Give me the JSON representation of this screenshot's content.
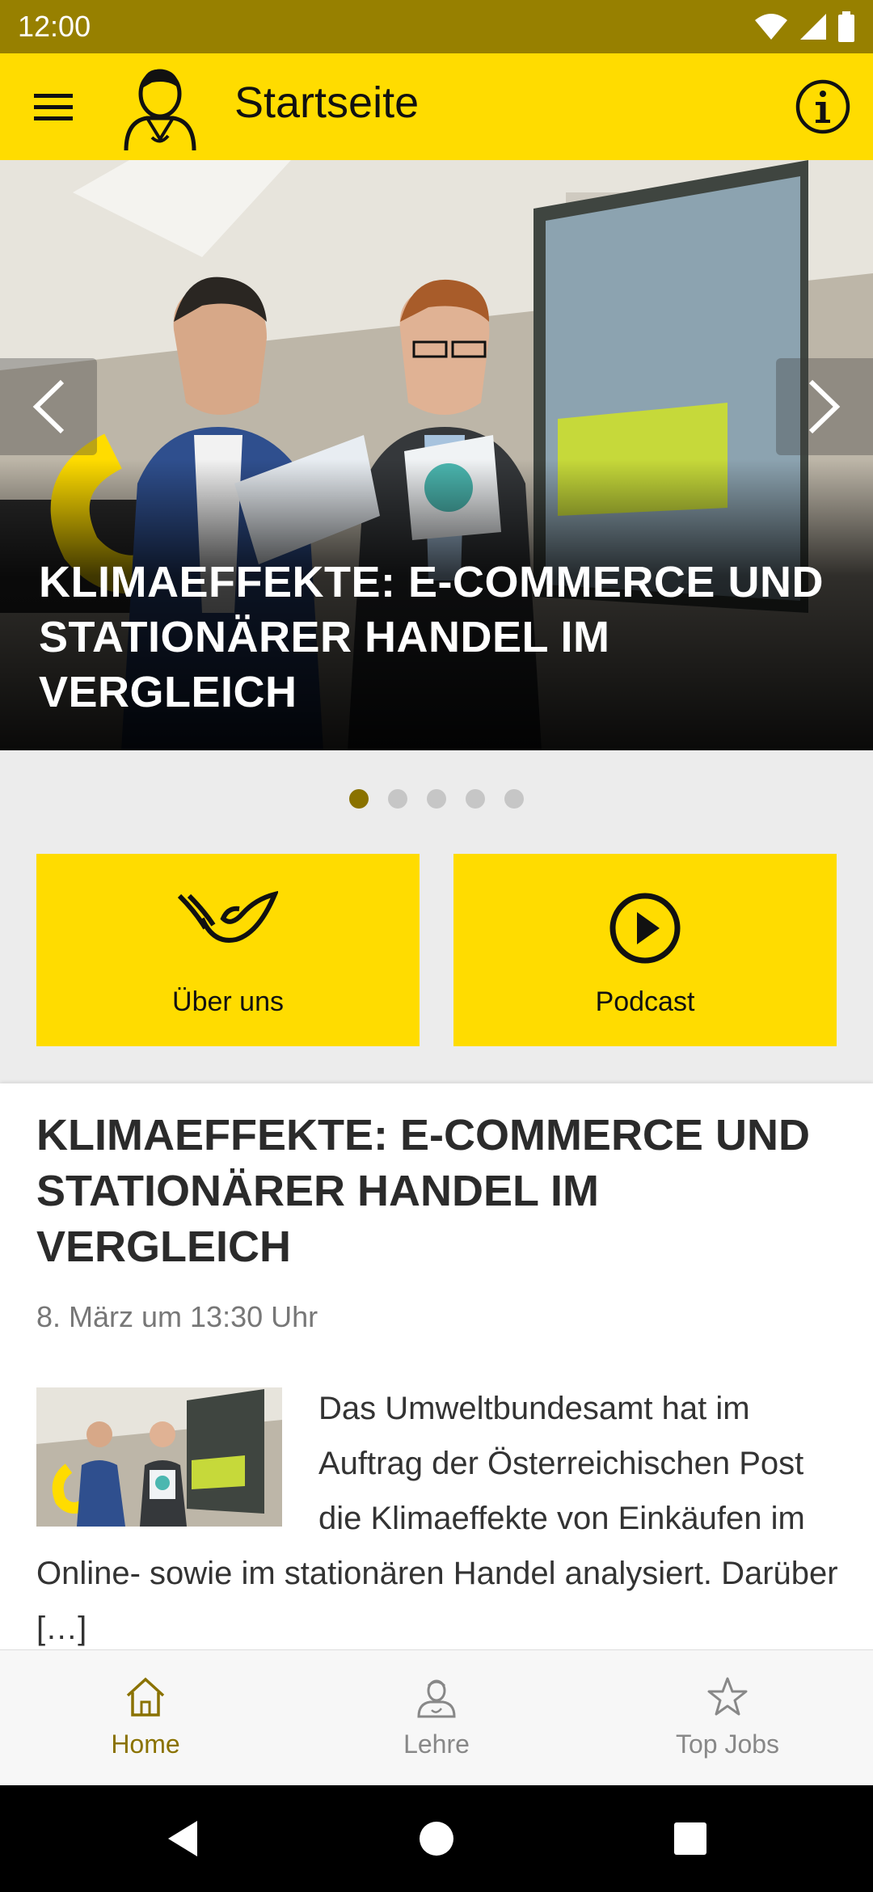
{
  "status_bar": {
    "time": "12:00"
  },
  "app_bar": {
    "title": "Startseite"
  },
  "hero": {
    "title": "KLIMAEFFEKTE: E-COMMERCE UND STATIONÄRER HANDEL IM VERGLEICH",
    "slide_count": 5,
    "active_slide": 1
  },
  "tiles": [
    {
      "label": "Über uns",
      "icon": "post-horn-icon"
    },
    {
      "label": "Podcast",
      "icon": "play-circle-icon"
    }
  ],
  "article": {
    "title": "KLIMAEFFEKTE: E-COMMERCE UND STATIONÄRER HANDEL IM VERGLEICH",
    "date": "8. März um 13:30 Uhr",
    "excerpt": "Das Umweltbundesamt hat im Auftrag der Österreichischen Post die Klimaeffekte von Einkäufen im Online- sowie im stationären Handel analysiert. Darüber […]"
  },
  "bottom_nav": [
    {
      "label": "Home",
      "icon": "home-icon",
      "active": true
    },
    {
      "label": "Lehre",
      "icon": "apprentice-icon",
      "active": false
    },
    {
      "label": "Top Jobs",
      "icon": "star-icon",
      "active": false
    }
  ],
  "colors": {
    "brand_yellow": "#ffdc00",
    "status_bar": "#978000",
    "accent": "#8a7200"
  }
}
